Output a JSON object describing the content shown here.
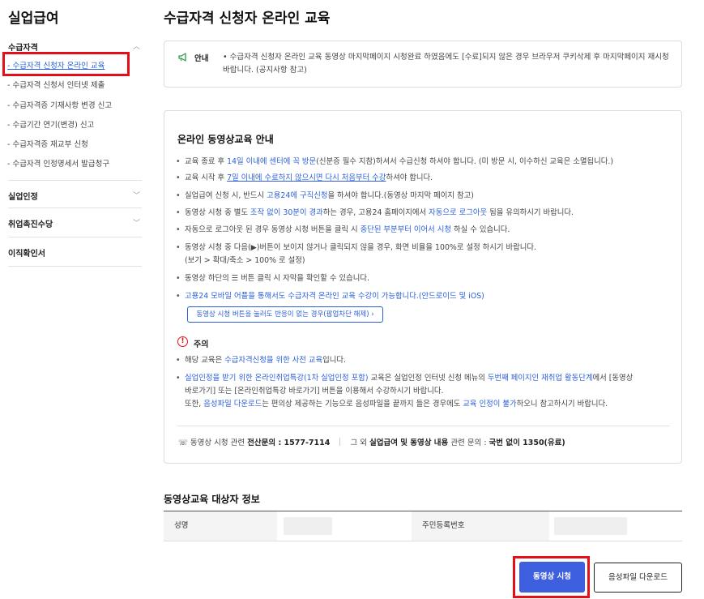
{
  "sidebar": {
    "title": "실업급여",
    "sections": [
      {
        "label": "수급자격",
        "expanded": true
      },
      {
        "label": "실업인정",
        "expanded": false
      },
      {
        "label": "취업촉진수당",
        "expanded": false
      },
      {
        "label": "이직확인서",
        "expanded": false
      }
    ],
    "items": [
      "- 수급자격 신청자 온라인 교육",
      "- 수급자격 신청서 인터넷 제출",
      "- 수급자격증 기재사항 변경 신고",
      "- 수급기간 연기(변경) 신고",
      "- 수급자격증 재교부 신청",
      "- 수급자격 인정명세서 발급청구"
    ],
    "chevron_up": "︿",
    "chevron_down": "﹀"
  },
  "page": {
    "title": "수급자격 신청자 온라인 교육"
  },
  "notice": {
    "tag": "안내",
    "text": "• 수급자격 신청자 온라인 교육 동영상 마지막페이지 시청완료 하였음에도 [수료]되지 않은 경우 브라우저 쿠키삭제 후 마지막페이지 재시청 바랍니다. (공지사항 참고)"
  },
  "guide": {
    "title": "온라인 동영상교육 안내",
    "b1": {
      "a": "교육 종료 후 ",
      "b": "14일 이내에 센터에 꼭 방문",
      "c": "(신분증 필수 지참)하셔서 수급신청 하셔야 합니다. (미 방문 시, 이수하신 교육은 소멸됩니다.)"
    },
    "b2": {
      "a": "교육 시작 후 ",
      "b": "7일 이내에 수료하지 않으시면 다시 처음부터 수강",
      "c": "하셔야 합니다."
    },
    "b3": {
      "a": "실업급여 신청 시, 반드시 ",
      "b": "고용24에 구직신청",
      "c": "을 하셔야 합니다.(동영상 마지막 페이지 참고)"
    },
    "b4": {
      "a": "동영상 시청 중 별도 ",
      "b": "조작 없이 30분이 경과",
      "c": "하는 경우, 고용24 홈페이지에서 ",
      "d": "자동으로 로그아웃",
      "e": " 됨을 유의하시기 바랍니다."
    },
    "b5": {
      "a": "자동으로 로그아웃 된 경우 동영상 시청 버튼을 클릭 시 ",
      "b": "중단된 부분부터 이어서 시청",
      "c": " 하실 수 있습니다."
    },
    "b6": {
      "a": "동영상 시청 중 다음(▶)버튼이 보이지 않거나 클릭되지 않을 경우, 화면 비율을 100%로 설정 하시기 바랍니다.",
      "b": "(보기 > 확대/축소 > 100% 로 설정)"
    },
    "b7": "동영상 하단의 ☰ 버튼 클릭 시 자막을 확인할 수 있습니다.",
    "b8": "고용24 모바일 어플을 통해서도 수급자격 온라인 교육 수강이 가능합니다.(안드로이드 및 iOS)",
    "popup_button": "동영상 시청 버튼을 눌러도 반응이 없는 경우(팝업차단 해제)  ›",
    "caution": {
      "icon_glyph": "!",
      "label": "주의",
      "c1": {
        "a": "해당 교육은 ",
        "b": "수급자격신청을 위한 사전 교육",
        "c": "입니다."
      },
      "c2": {
        "a": "실업인정을 받기 위한 온라인취업특강(1차 실업인정 포함)",
        "b": " 교육은 실업인정 인터넷 신청 메뉴의 ",
        "c": "두번째 페이지인 재취업 활동단계",
        "d": "에서 [동영상",
        "e": "바로가기] 또는 [온라인취업특강 바로가기] 버튼을 이용해서 수강하시기 바랍니다.",
        "f": "또한, ",
        "g": "음성파일 다운로드",
        "h": "는 편의상 제공하는 기능으로 음성파일을 끝까지 들은 경우에도 ",
        "i": "교육 인정이 불가",
        "j": "하오니 참고하시기 바랍니다."
      }
    },
    "contact": {
      "phone_glyph": "☏",
      "a": "동영상 시청 관련 ",
      "b": "전산문의 : 1577-7114",
      "c": "그 외 ",
      "d": "실업급여 및 동영상 내용",
      "e": " 관련 문의 : ",
      "f": "국번 없이 1350(유료)"
    }
  },
  "info": {
    "title": "동영상교육 대상자 정보",
    "name_label": "성명",
    "rrn_label": "주민등록번호"
  },
  "buttons": {
    "watch": "동영상 시청",
    "audio": "음성파일 다운로드"
  },
  "colors": {
    "accent": "#3d5fe0",
    "link": "#2b5fd9",
    "highlight_box": "#e3101a",
    "notice_icon": "#2e9b4f"
  }
}
